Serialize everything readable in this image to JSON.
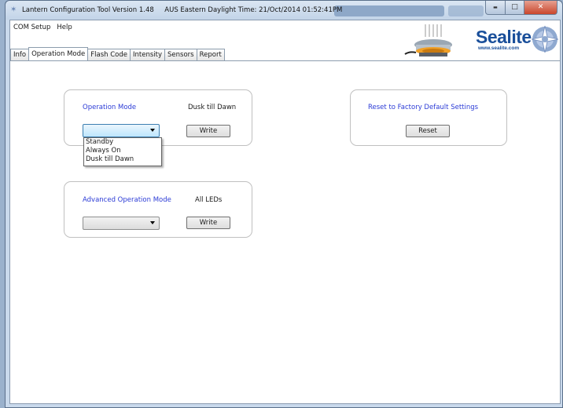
{
  "window": {
    "title": "Lantern Configuration Tool Version 1.48     AUS Eastern Daylight Time: 21/Oct/2014 01:52:41PM",
    "min_glyph": "▬",
    "max_glyph": "□",
    "close_glyph": "✕"
  },
  "menu": [
    {
      "label": "COM Setup"
    },
    {
      "label": "Help"
    }
  ],
  "logo": {
    "brand": "Sealite",
    "url": "www.sealite.com"
  },
  "tabs": [
    {
      "label": "Info"
    },
    {
      "label": "Operation Mode"
    },
    {
      "label": "Flash Code"
    },
    {
      "label": "Intensity"
    },
    {
      "label": "Sensors"
    },
    {
      "label": "Report"
    }
  ],
  "active_tab": "Operation Mode",
  "operation_mode": {
    "title": "Operation Mode",
    "current_value": "Dusk till Dawn",
    "selected": "",
    "write_label": "Write",
    "options": [
      "Standby",
      "Always On",
      "Dusk till Dawn"
    ]
  },
  "advanced_mode": {
    "title": "Advanced Operation Mode",
    "current_value": "All LEDs",
    "selected": "",
    "write_label": "Write"
  },
  "reset": {
    "title": "Reset to Factory Default Settings",
    "button_label": "Reset"
  },
  "colors": {
    "label_blue": "#2b3bd6",
    "brand_blue": "#1a4f9a"
  }
}
